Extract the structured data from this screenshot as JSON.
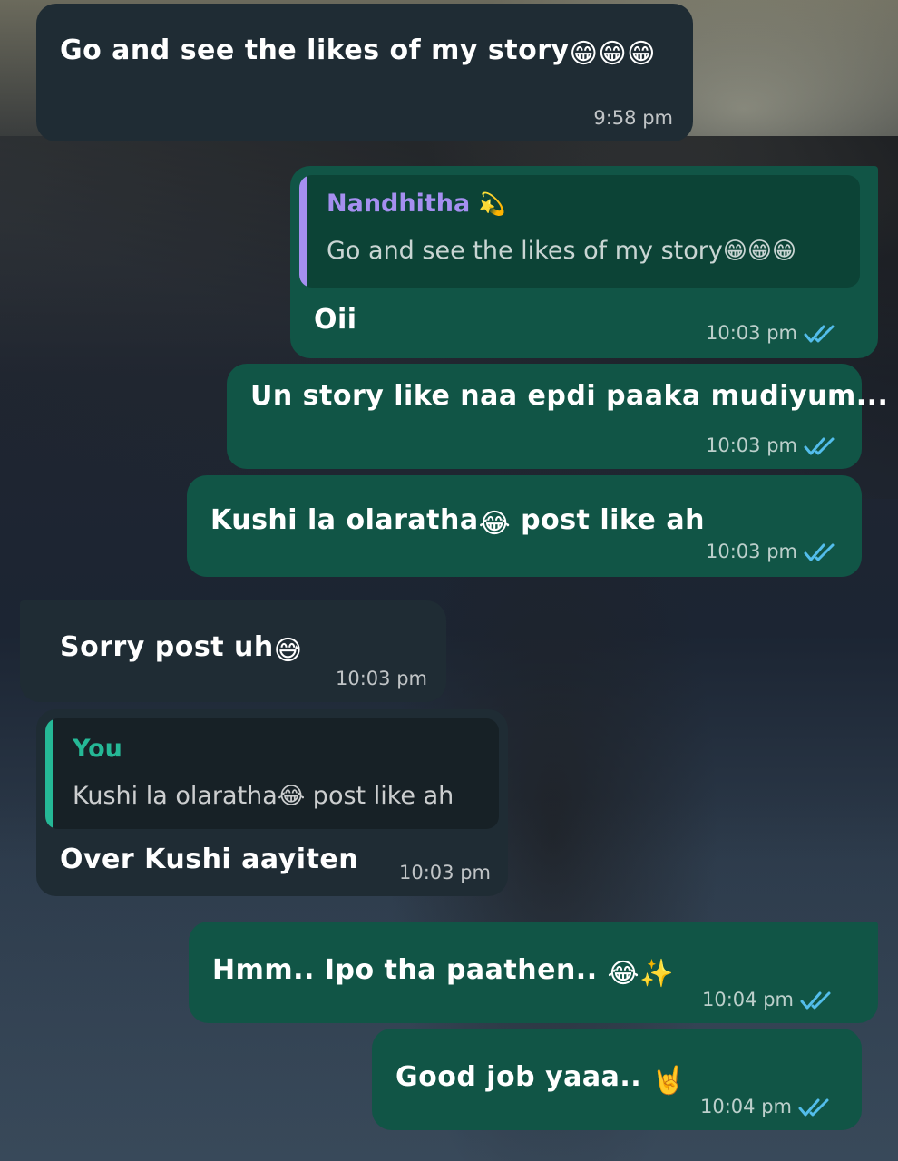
{
  "chat": {
    "messages": [
      {
        "direction": "incoming",
        "text": "Go and see the likes of my story",
        "emoji": "😁😁😁",
        "time": "9:58 pm"
      },
      {
        "direction": "outgoing",
        "reply_to": {
          "name": "Nandhitha",
          "name_emoji": "💫",
          "text": "Go and see the likes of my story",
          "emoji": "😁😁😁"
        },
        "text": "Oii",
        "time": "10:03 pm",
        "status": "read"
      },
      {
        "direction": "outgoing",
        "text": "Un story like naa epdi paaka mudiyum...",
        "time": "10:03 pm",
        "status": "read"
      },
      {
        "direction": "outgoing",
        "text_before": "Kushi la olaratha",
        "emoji": "😂",
        "text_after": " post like ah",
        "time": "10:03 pm",
        "status": "read"
      },
      {
        "direction": "incoming",
        "text": "Sorry post uh",
        "emoji": "😅",
        "time": "10:03 pm"
      },
      {
        "direction": "incoming",
        "reply_to": {
          "name": "You",
          "text_before": "Kushi la olaratha",
          "emoji": "😂",
          "text_after": " post like ah"
        },
        "text": "Over Kushi aayiten",
        "time": "10:03 pm"
      },
      {
        "direction": "outgoing",
        "text": "Hmm.. Ipo tha paathen.. ",
        "emoji": "😂✨",
        "time": "10:04 pm",
        "status": "read"
      },
      {
        "direction": "outgoing",
        "text": "Good job yaaa.. ",
        "emoji": "🤘",
        "time": "10:04 pm",
        "status": "read"
      }
    ]
  },
  "colors": {
    "incoming_bubble": "#1f2c34",
    "outgoing_bubble": "#115546",
    "read_ticks": "#53bdeb",
    "reply_name_nandhitha": "#a58ff0",
    "reply_name_you": "#25b896"
  },
  "icons": {
    "read_receipt": "double-check-icon"
  }
}
